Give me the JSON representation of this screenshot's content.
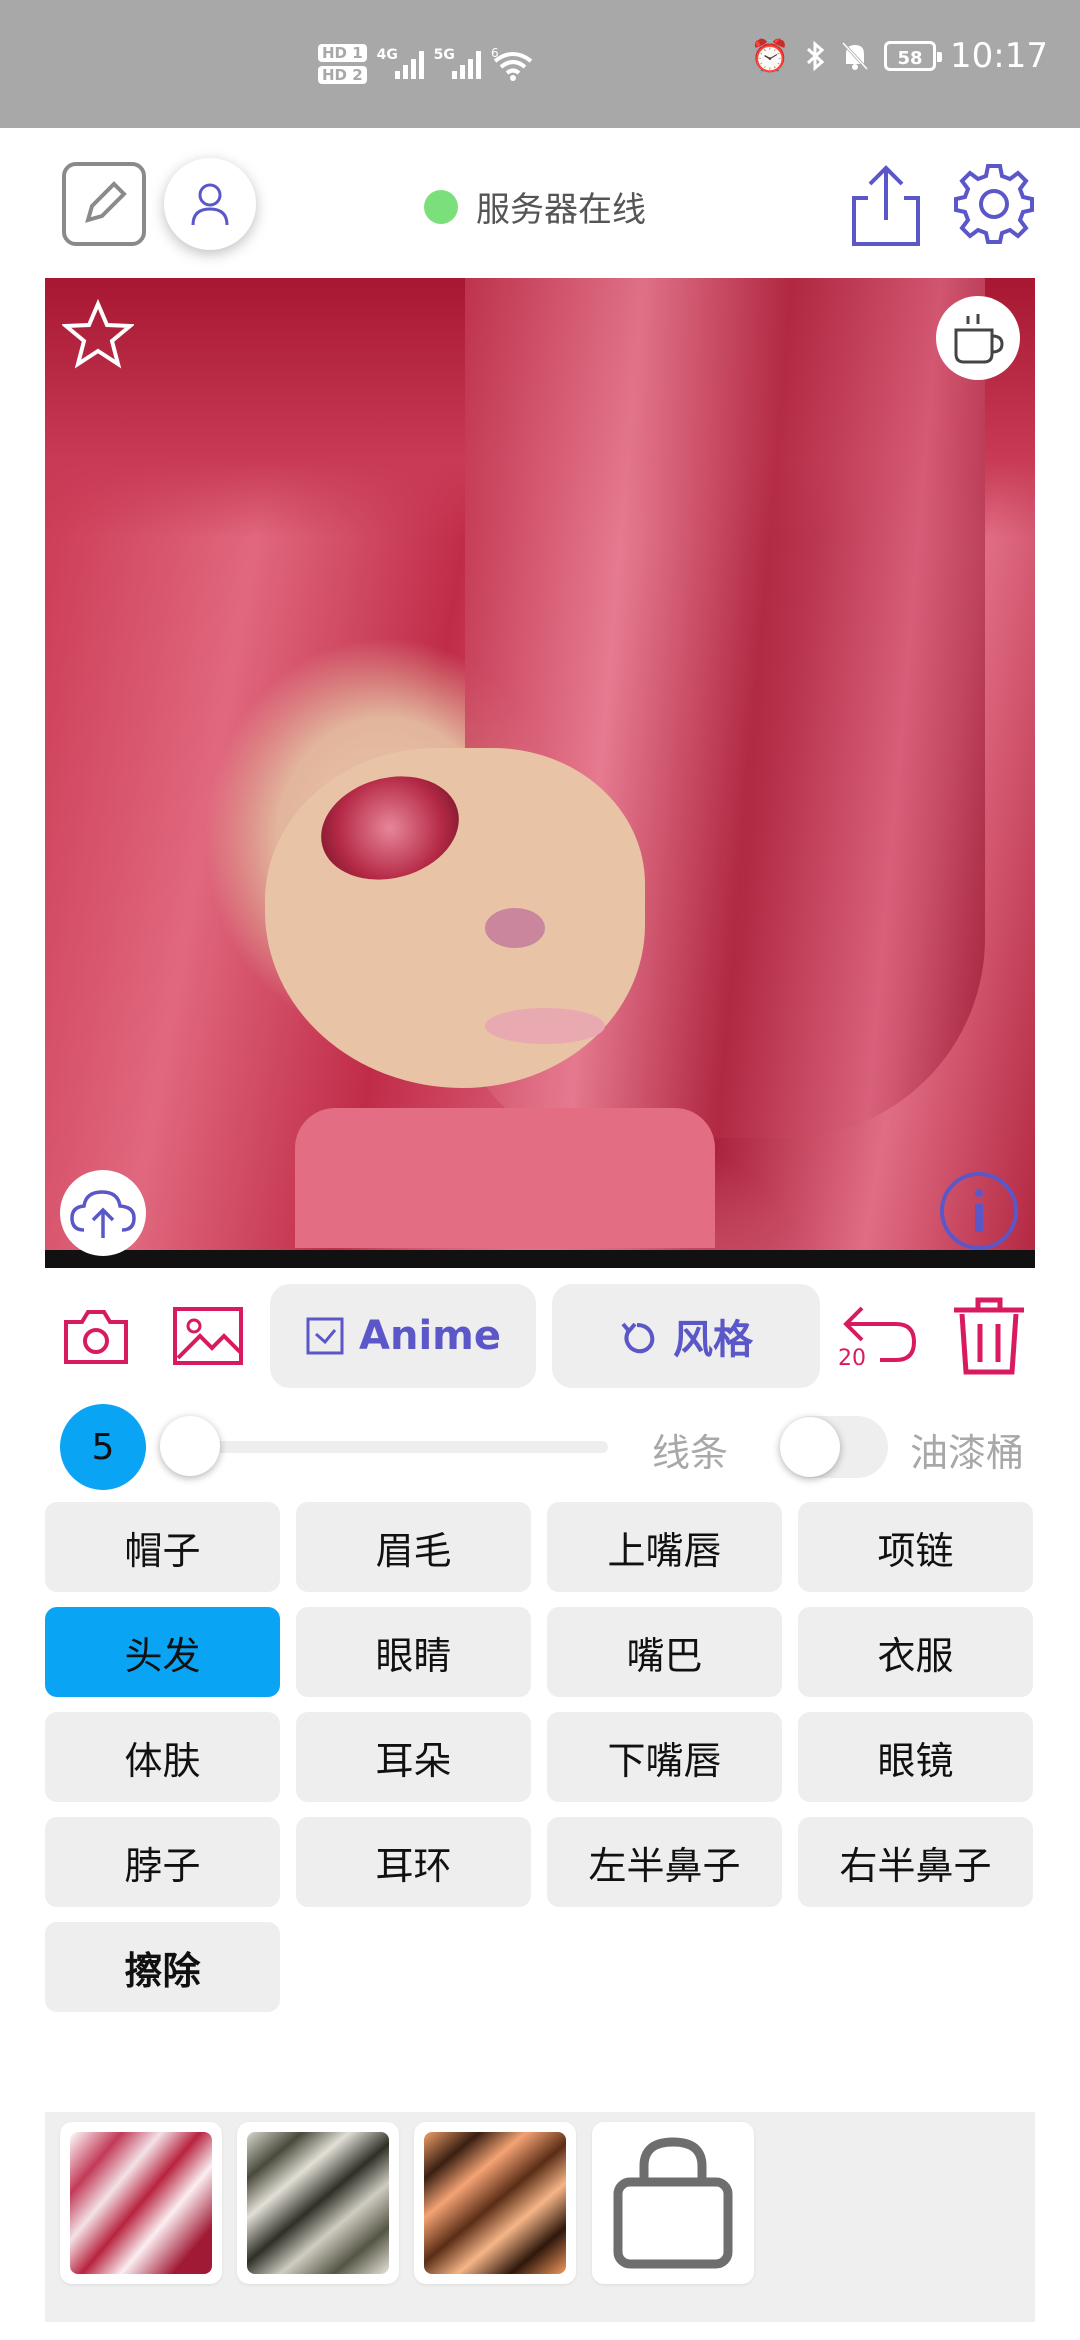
{
  "status_bar": {
    "hd1": "HD 1",
    "hd2": "HD 2",
    "net1": "4G",
    "net2": "5G",
    "wifi_level": "6",
    "battery": "58",
    "time": "10:17"
  },
  "header": {
    "server_status": "服务器在线",
    "server_status_color": "#7be07b",
    "accent_color": "#5b57c9"
  },
  "toolbar": {
    "anime_label": "Anime",
    "style_label": "风格",
    "undo_count": "20",
    "primary_red": "#d81b60"
  },
  "brush": {
    "size": "5",
    "lines_label": "线条",
    "bucket_label": "油漆桶",
    "lines_enabled": false,
    "bucket_enabled": false
  },
  "parts": [
    {
      "label": "帽子",
      "selected": false
    },
    {
      "label": "眉毛",
      "selected": false
    },
    {
      "label": "上嘴唇",
      "selected": false
    },
    {
      "label": "项链",
      "selected": false
    },
    {
      "label": "头发",
      "selected": true
    },
    {
      "label": "眼睛",
      "selected": false
    },
    {
      "label": "嘴巴",
      "selected": false
    },
    {
      "label": "衣服",
      "selected": false
    },
    {
      "label": "体肤",
      "selected": false
    },
    {
      "label": "耳朵",
      "selected": false
    },
    {
      "label": "下嘴唇",
      "selected": false
    },
    {
      "label": "眼镜",
      "selected": false
    },
    {
      "label": "脖子",
      "selected": false
    },
    {
      "label": "耳环",
      "selected": false
    },
    {
      "label": "左半鼻子",
      "selected": false
    },
    {
      "label": "右半鼻子",
      "selected": false
    },
    {
      "label": "擦除",
      "selected": false
    }
  ],
  "icons": {
    "edit": "edit-icon",
    "user": "user-icon",
    "share": "share-icon",
    "settings": "gear-icon",
    "favorite": "star-icon",
    "coffee": "coffee-cup-icon",
    "upload": "cloud-upload-icon",
    "info": "info-icon",
    "camera": "camera-icon",
    "gallery": "image-icon",
    "undo": "undo-icon",
    "trash": "trash-icon",
    "shop": "shopping-bag-icon"
  },
  "selected_color": "#0aa4f5"
}
